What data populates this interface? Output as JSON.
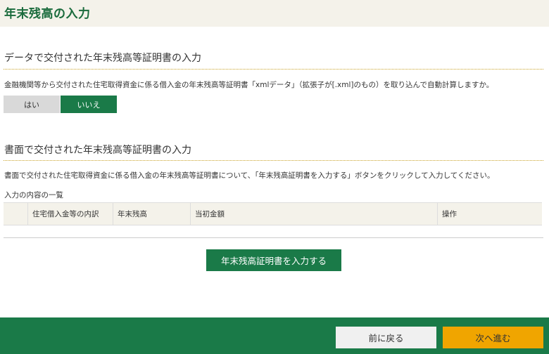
{
  "page": {
    "title": "年末残高の入力"
  },
  "section_xml": {
    "title": "データで交付された年末残高等証明書の入力",
    "description": "金融機関等から交付された住宅取得資金に係る借入金の年末残高等証明書「xmlデータ」（拡張子が[.xml]のもの）を取り込んで自動計算しますか。",
    "yes_label": "はい",
    "no_label": "いいえ",
    "selected": "いいえ"
  },
  "section_paper": {
    "title": "書面で交付された年末残高等証明書の入力",
    "description": "書面で交付された住宅取得資金に係る借入金の年末残高等証明書について、「年末残高証明書を入力する」ボタンをクリックして入力してください。",
    "list_label": "入力の内容の一覧",
    "columns": [
      "",
      "住宅借入金等の内訳",
      "年末残高",
      "当初金額",
      "操作"
    ],
    "input_button": "年末残高証明書を入力する"
  },
  "footer": {
    "back_label": "前に戻る",
    "next_label": "次へ進む"
  },
  "colors": {
    "primary_green": "#1a7a48",
    "title_green": "#1a6b3c",
    "next_orange": "#f0a500",
    "header_beige": "#f4f2ea"
  }
}
